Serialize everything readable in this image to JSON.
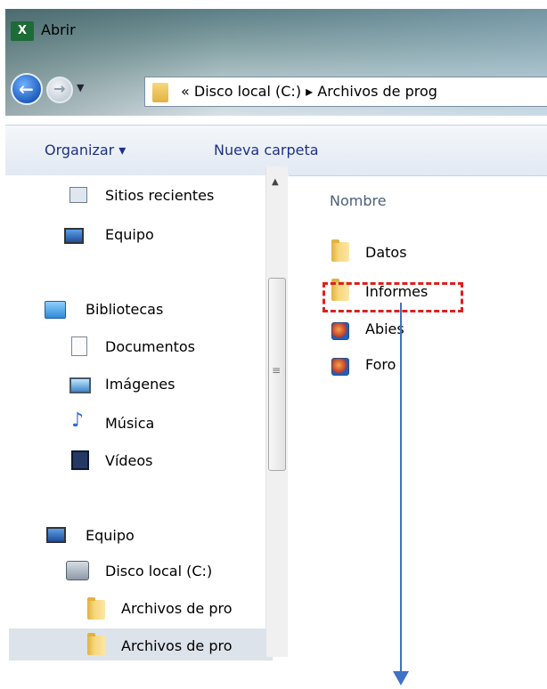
{
  "window": {
    "title": "Abrir",
    "app_icon": "excel-icon"
  },
  "navigation": {
    "back_icon": "back-arrow-icon",
    "forward_icon": "forward-arrow-icon",
    "recent_dropdown_icon": "chevron-down-icon"
  },
  "address_bar": {
    "path_text": "« Disco local (C:) ▸ Archivos de prog"
  },
  "toolbar": {
    "organize_label": "Organizar ▾",
    "new_folder_label": "Nueva carpeta"
  },
  "nav_pane": {
    "items": [
      {
        "label": "Sitios recientes",
        "icon": "recent-places-icon"
      },
      {
        "label": "Equipo",
        "icon": "computer-icon"
      },
      {
        "label": "Bibliotecas",
        "icon": "libraries-icon"
      },
      {
        "label": "Documentos",
        "icon": "documents-icon"
      },
      {
        "label": "Imágenes",
        "icon": "pictures-icon"
      },
      {
        "label": "Música",
        "icon": "music-icon"
      },
      {
        "label": "Vídeos",
        "icon": "videos-icon"
      },
      {
        "label": "Equipo",
        "icon": "computer-icon"
      },
      {
        "label": "Disco local (C:)",
        "icon": "local-disk-icon"
      },
      {
        "label": "Archivos de pro",
        "icon": "folder-icon"
      },
      {
        "label": "Archivos de pro",
        "icon": "folder-icon",
        "selected": true
      }
    ]
  },
  "content": {
    "column_header": "Nombre",
    "items": [
      {
        "label": "Datos",
        "icon": "folder-icon"
      },
      {
        "label": "Informes",
        "icon": "folder-icon",
        "highlighted": true
      },
      {
        "label": "Abies",
        "icon": "shortcut-icon"
      },
      {
        "label": "Foro",
        "icon": "shortcut-icon"
      }
    ]
  },
  "annotation": {
    "highlight_color": "#e0201c",
    "arrow_color": "#3f72c4"
  }
}
